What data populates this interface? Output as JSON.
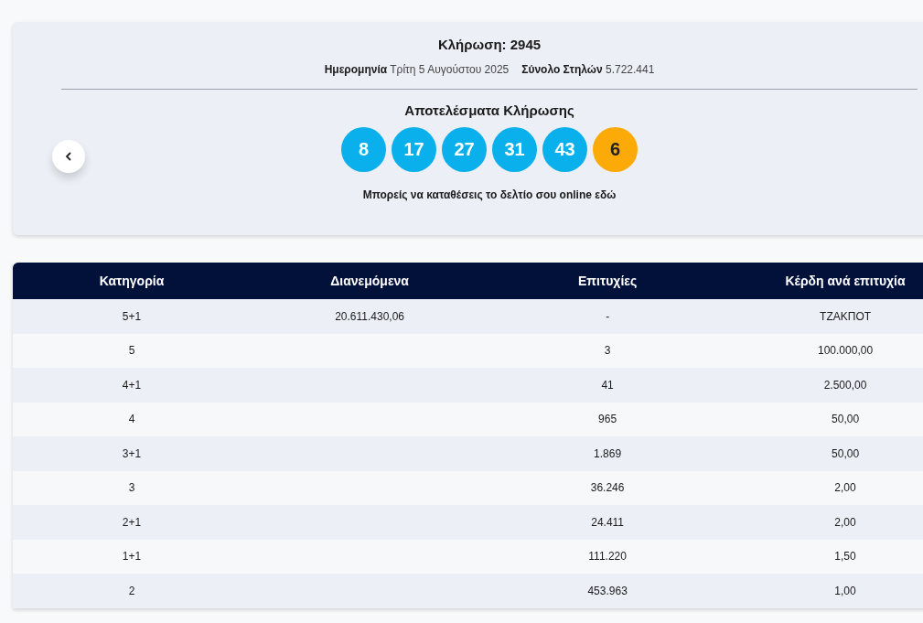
{
  "draw": {
    "title": "Κλήρωση: 2945",
    "date_label": "Ημερομηνία",
    "date": "Τρίτη 5 Αυγούστου 2025",
    "columns_label": "Σύνολο Στηλών",
    "columns": "5.722.441",
    "results_title": "Αποτελέσματα Κλήρωσης",
    "balls": [
      {
        "number": "8",
        "kind": "main"
      },
      {
        "number": "17",
        "kind": "main"
      },
      {
        "number": "27",
        "kind": "main"
      },
      {
        "number": "31",
        "kind": "main"
      },
      {
        "number": "43",
        "kind": "main"
      },
      {
        "number": "6",
        "kind": "bonus"
      }
    ],
    "online_note": "Μπορείς να καταθέσεις το δελτίο σου online εδώ"
  },
  "table": {
    "columns": [
      "Κατηγορία",
      "Διανεμόμενα",
      "Επιτυχίες",
      "Κέρδη ανά επιτυχία"
    ],
    "rows": [
      [
        "5+1",
        "20.611.430,06",
        "-",
        "ΤΖΑΚΠΟΤ"
      ],
      [
        "5",
        "",
        "3",
        "100.000,00"
      ],
      [
        "4+1",
        "",
        "41",
        "2.500,00"
      ],
      [
        "4",
        "",
        "965",
        "50,00"
      ],
      [
        "3+1",
        "",
        "1.869",
        "50,00"
      ],
      [
        "3",
        "",
        "36.246",
        "2,00"
      ],
      [
        "2+1",
        "",
        "24.411",
        "2,00"
      ],
      [
        "1+1",
        "",
        "111.220",
        "1,50"
      ],
      [
        "2",
        "",
        "453.963",
        "1,00"
      ]
    ]
  }
}
